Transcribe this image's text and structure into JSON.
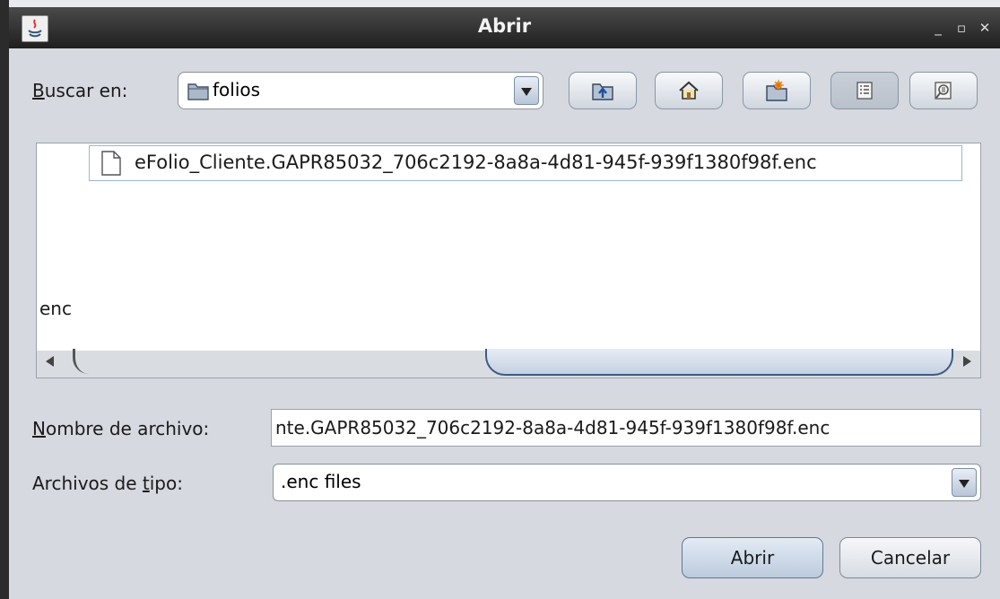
{
  "window": {
    "title": "Abrir",
    "minimize_glyph": "_",
    "maximize_glyph": "▫",
    "close_glyph": "✕"
  },
  "lookin": {
    "label_first": "B",
    "label_rest": "uscar en:",
    "folder": "folios"
  },
  "toolbar": {
    "icons": [
      "up-folder-icon",
      "home-icon",
      "new-folder-icon",
      "list-view-icon",
      "details-view-icon"
    ]
  },
  "filelist": {
    "items": [
      {
        "name": "eFolio_Cliente.GAPR85032_706c2192-8a8a-4d81-945f-939f1380f98f.enc",
        "icon": "file-icon"
      }
    ],
    "stray_text": "enc"
  },
  "filename": {
    "label_first": "N",
    "label_rest": "ombre de archivo:",
    "value": "nte.GAPR85032_706c2192-8a8a-4d81-945f-939f1380f98f.enc"
  },
  "filetype": {
    "label_pre": "Archivos de ",
    "label_under": "t",
    "label_post": "ipo:",
    "selected": ".enc files"
  },
  "buttons": {
    "open": "Abrir",
    "cancel": "Cancelar"
  }
}
